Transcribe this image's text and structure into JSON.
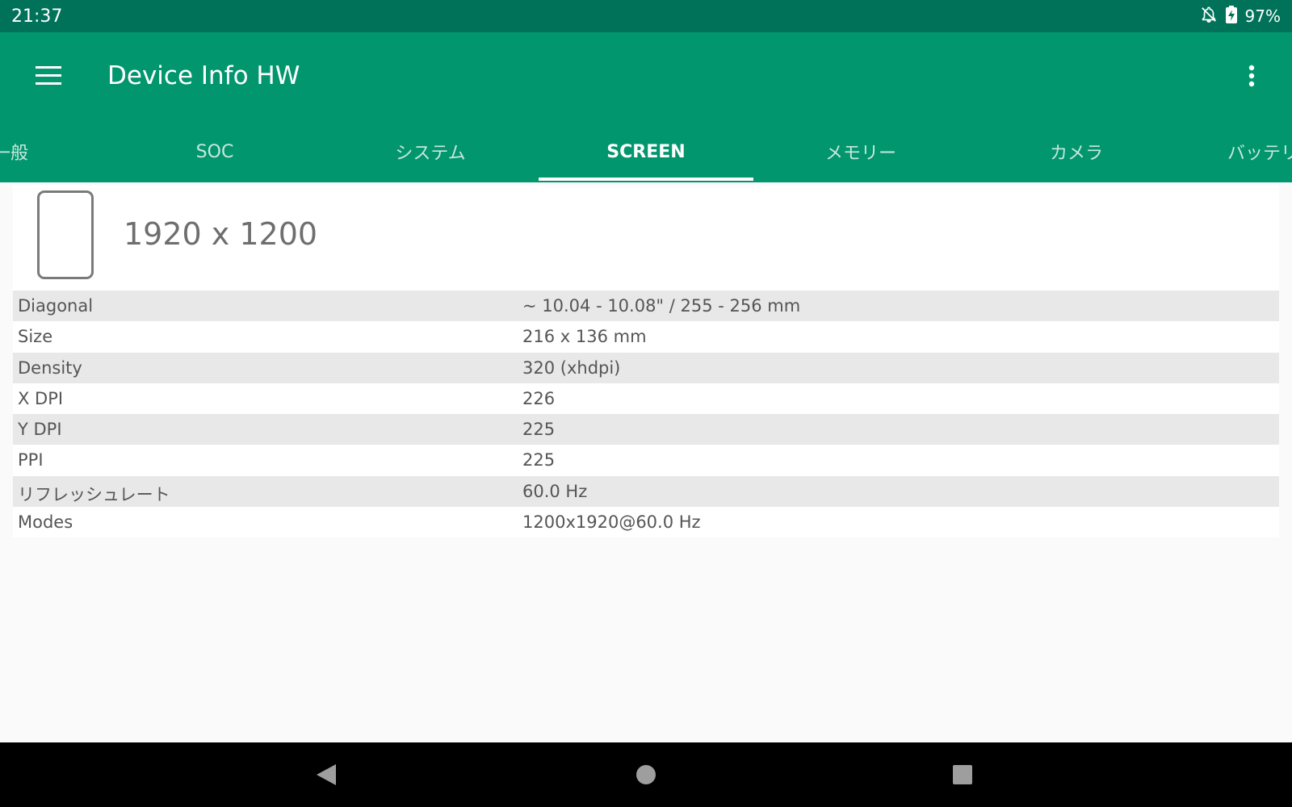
{
  "status_bar": {
    "time": "21:37",
    "battery": "97%",
    "icons": [
      "notifications-off-icon",
      "battery-charging-icon"
    ]
  },
  "toolbar": {
    "title": "Device Info HW",
    "menu_icon": "hamburger-menu-icon",
    "overflow_icon": "more-vert-icon"
  },
  "tabs": [
    {
      "label": "一般",
      "active": false
    },
    {
      "label": "SOC",
      "active": false
    },
    {
      "label": "システム",
      "active": false
    },
    {
      "label": "SCREEN",
      "active": true
    },
    {
      "label": "メモリー",
      "active": false
    },
    {
      "label": "カメラ",
      "active": false
    },
    {
      "label": "バッテリー",
      "active": false
    }
  ],
  "screen": {
    "icon": "screen-device-icon",
    "resolution": "1920 x 1200",
    "rows": [
      {
        "label": "Diagonal",
        "value": "~ 10.04 - 10.08\" / 255 - 256 mm"
      },
      {
        "label": "Size",
        "value": "216 x 136 mm"
      },
      {
        "label": "Density",
        "value": "320 (xhdpi)"
      },
      {
        "label": "X DPI",
        "value": "226"
      },
      {
        "label": "Y DPI",
        "value": "225"
      },
      {
        "label": "PPI",
        "value": "225"
      },
      {
        "label": "リフレッシュレート",
        "value": "60.0 Hz"
      },
      {
        "label": "Modes",
        "value": "1200x1920@60.0 Hz"
      }
    ]
  },
  "nav_bar": {
    "back_icon": "back-triangle-icon",
    "home_icon": "home-circle-icon",
    "recents_icon": "recents-square-icon"
  },
  "colors": {
    "status_bar": "#00725a",
    "app_bar": "#02966e",
    "row_alt": "#e8e8e8"
  }
}
